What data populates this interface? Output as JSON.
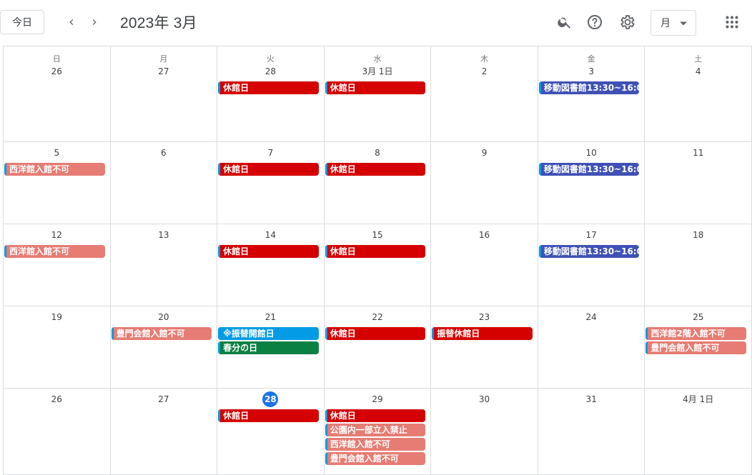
{
  "toolbar": {
    "today_label": "今日",
    "title": "2023年 3月",
    "view_label": "月"
  },
  "colors": {
    "closed": "#d50000",
    "outreach": "#3f51b5",
    "restricted": "#e67c73",
    "special_open": "#039be5",
    "holiday": "#0b8043",
    "today": "#1a73e8"
  },
  "weekdays": [
    "日",
    "月",
    "火",
    "水",
    "木",
    "金",
    "土"
  ],
  "days": [
    {
      "label": "26",
      "events": []
    },
    {
      "label": "27",
      "events": []
    },
    {
      "label": "28",
      "events": [
        {
          "title": "休館日",
          "color": "#d50000"
        }
      ]
    },
    {
      "label": "3月 1日",
      "events": [
        {
          "title": "休館日",
          "color": "#d50000"
        }
      ]
    },
    {
      "label": "2",
      "events": []
    },
    {
      "label": "3",
      "events": [
        {
          "title": "移動図書館13:30~16:0",
          "color": "#3f51b5"
        }
      ]
    },
    {
      "label": "4",
      "events": []
    },
    {
      "label": "5",
      "events": [
        {
          "title": "西洋館入館不可",
          "color": "#e67c73"
        }
      ]
    },
    {
      "label": "6",
      "events": []
    },
    {
      "label": "7",
      "events": [
        {
          "title": "休館日",
          "color": "#d50000"
        }
      ]
    },
    {
      "label": "8",
      "events": [
        {
          "title": "休館日",
          "color": "#d50000"
        }
      ]
    },
    {
      "label": "9",
      "events": []
    },
    {
      "label": "10",
      "events": [
        {
          "title": "移動図書館13:30~16:0",
          "color": "#3f51b5"
        }
      ]
    },
    {
      "label": "11",
      "events": []
    },
    {
      "label": "12",
      "events": [
        {
          "title": "西洋館入館不可",
          "color": "#e67c73"
        }
      ]
    },
    {
      "label": "13",
      "events": []
    },
    {
      "label": "14",
      "events": [
        {
          "title": "休館日",
          "color": "#d50000"
        }
      ]
    },
    {
      "label": "15",
      "events": [
        {
          "title": "休館日",
          "color": "#d50000"
        }
      ]
    },
    {
      "label": "16",
      "events": []
    },
    {
      "label": "17",
      "events": [
        {
          "title": "移動図書館13:30~16:0",
          "color": "#3f51b5"
        }
      ]
    },
    {
      "label": "18",
      "events": []
    },
    {
      "label": "19",
      "events": []
    },
    {
      "label": "20",
      "events": [
        {
          "title": "豊門会館入館不可",
          "color": "#e67c73"
        }
      ]
    },
    {
      "label": "21",
      "events": [
        {
          "title": "※振替開館日",
          "color": "#039be5"
        },
        {
          "title": "春分の日",
          "color": "#0b8043"
        }
      ]
    },
    {
      "label": "22",
      "events": [
        {
          "title": "休館日",
          "color": "#d50000"
        }
      ]
    },
    {
      "label": "23",
      "events": [
        {
          "title": "振替休館日",
          "color": "#d50000"
        }
      ]
    },
    {
      "label": "24",
      "events": []
    },
    {
      "label": "25",
      "events": [
        {
          "title": "西洋館2階入館不可",
          "color": "#e67c73"
        },
        {
          "title": "豊門会館入館不可",
          "color": "#e67c73"
        }
      ]
    },
    {
      "label": "26",
      "events": []
    },
    {
      "label": "27",
      "events": []
    },
    {
      "label": "28",
      "today": true,
      "events": [
        {
          "title": "休館日",
          "color": "#d50000"
        }
      ]
    },
    {
      "label": "29",
      "events": [
        {
          "title": "休館日",
          "color": "#d50000"
        },
        {
          "title": "公園内一部立入禁止",
          "color": "#e67c73"
        },
        {
          "title": "西洋館入館不可",
          "color": "#e67c73"
        },
        {
          "title": "豊門会館入館不可",
          "color": "#e67c73"
        }
      ]
    },
    {
      "label": "30",
      "events": []
    },
    {
      "label": "31",
      "events": []
    },
    {
      "label": "4月 1日",
      "events": []
    }
  ]
}
